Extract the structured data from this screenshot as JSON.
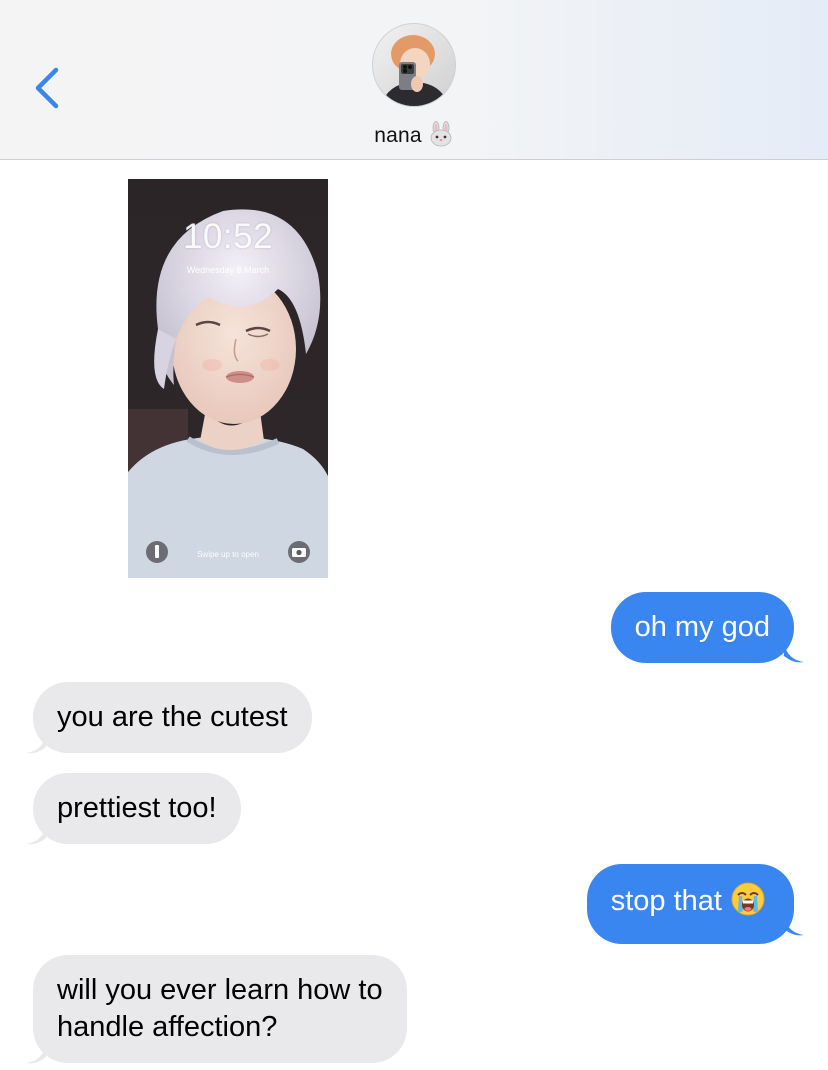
{
  "header": {
    "contact_name": "nana",
    "contact_emoji": "rabbit-face-icon",
    "back_icon": "chevron-left-icon"
  },
  "colors": {
    "accent": "#3a86f0",
    "incoming_bubble": "#e9e9eb",
    "outgoing_bubble": "#3a86f0",
    "header_bg": "#f3f4f6"
  },
  "media": {
    "lock_time": "10:52",
    "lock_date": "Wednesday 8 March",
    "lock_hint": "Swipe up to open",
    "left_icon": "flashlight-icon",
    "right_icon": "camera-icon"
  },
  "messages": [
    {
      "direction": "outgoing",
      "text": "oh my god"
    },
    {
      "direction": "incoming",
      "text": "you are the cutest"
    },
    {
      "direction": "incoming",
      "text": "prettiest too!"
    },
    {
      "direction": "outgoing",
      "text": "stop that",
      "emoji": "loudly-crying-face-icon"
    },
    {
      "direction": "incoming",
      "text_lines": [
        "will you ever learn how to",
        "handle affection?"
      ]
    }
  ]
}
